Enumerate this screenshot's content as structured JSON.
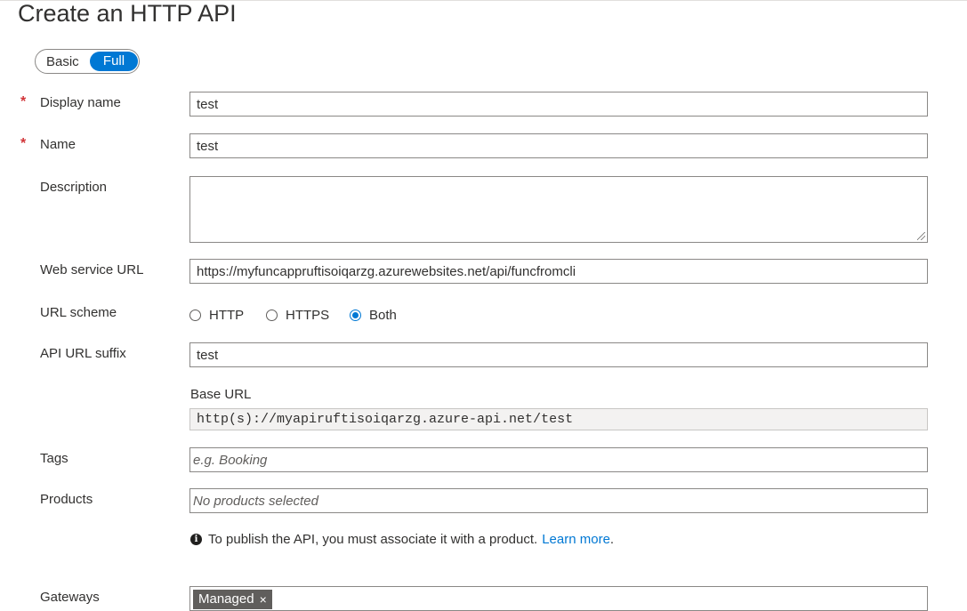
{
  "page": {
    "title": "Create an HTTP API"
  },
  "mode_toggle": {
    "basic": "Basic",
    "full": "Full",
    "selected": "Full"
  },
  "required_mark": "*",
  "fields": {
    "display_name": {
      "label": "Display name",
      "value": "test"
    },
    "name": {
      "label": "Name",
      "value": "test"
    },
    "description": {
      "label": "Description",
      "value": ""
    },
    "web_service_url": {
      "label": "Web service URL",
      "value": "https://myfuncappruftisoiqarzg.azurewebsites.net/api/funcfromcli"
    },
    "url_scheme": {
      "label": "URL scheme",
      "options": [
        "HTTP",
        "HTTPS",
        "Both"
      ],
      "selected": "Both"
    },
    "api_url_suffix": {
      "label": "API URL suffix",
      "value": "test"
    },
    "base_url": {
      "label": "Base URL",
      "value": "http(s)://myapiruftisoiqarzg.azure-api.net/test"
    },
    "tags": {
      "label": "Tags",
      "placeholder": "e.g. Booking"
    },
    "products": {
      "label": "Products",
      "placeholder": "No products selected"
    },
    "gateways": {
      "label": "Gateways",
      "chips": [
        {
          "label": "Managed",
          "remove": "×"
        }
      ]
    }
  },
  "info": {
    "icon": "info-icon",
    "icon_glyph": "i",
    "text": "To publish the API, you must associate it with a product.",
    "link": "Learn more",
    "after_link": "."
  },
  "colors": {
    "accent": "#0078d4",
    "required": "#d13438",
    "chip": "#605e5c"
  }
}
